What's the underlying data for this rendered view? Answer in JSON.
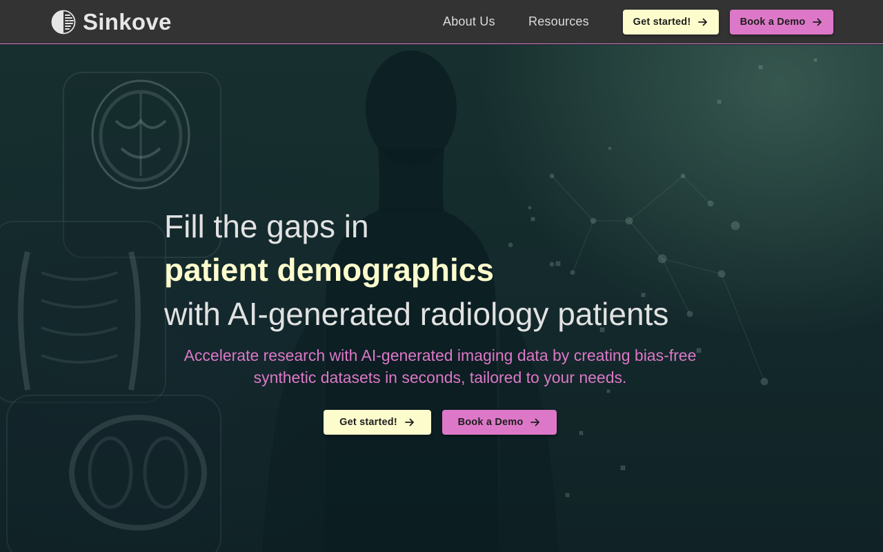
{
  "brand": {
    "name": "Sinkove",
    "logo_icon": "half-circle-dashed-logo-icon"
  },
  "nav": {
    "links": [
      {
        "label": "About Us"
      },
      {
        "label": "Resources"
      }
    ],
    "cta_primary": {
      "label": "Get started!",
      "icon": "arrow-right-icon"
    },
    "cta_secondary": {
      "label": "Book a Demo",
      "icon": "arrow-right-icon"
    }
  },
  "hero": {
    "headline_line1": "Fill the gaps in",
    "headline_line2": "patient demographics",
    "headline_line3": "with AI-generated radiology patients",
    "subtext": "Accelerate research with AI-generated imaging data by creating bias-free synthetic datasets in seconds, tailored to your needs.",
    "cta_primary": {
      "label": "Get started!",
      "icon": "arrow-right-icon"
    },
    "cta_secondary": {
      "label": "Book a Demo",
      "icon": "arrow-right-icon"
    }
  },
  "colors": {
    "header_bg": "#333333",
    "accent_yellow": "#fdfccd",
    "accent_pink": "#dd78c8",
    "hero_bg": "#142a2c",
    "text_light": "#e2e2e2"
  }
}
